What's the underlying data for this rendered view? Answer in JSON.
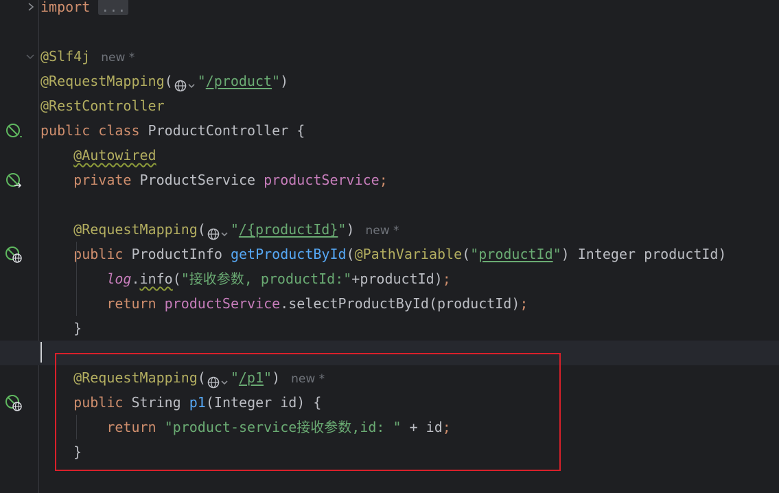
{
  "editor": {
    "lines": [
      {
        "tokens": [
          {
            "t": "import",
            "c": "#cf8e6d"
          },
          {
            "t": " "
          },
          {
            "t": "...",
            "s": "fold"
          }
        ]
      },
      {
        "tokens": []
      },
      {
        "tokens": [
          {
            "t": "@Slf4j",
            "c": "#b3ae60"
          },
          {
            "t": "new *",
            "s": "hint"
          }
        ]
      },
      {
        "tokens": [
          {
            "t": "@RequestMapping",
            "c": "#b3ae60"
          },
          {
            "t": "(",
            "c": "#bcbec4"
          },
          {
            "g": "url-icon"
          },
          {
            "t": "\"",
            "c": "#6aab73"
          },
          {
            "t": "/product",
            "c": "#6aab73",
            "s": "ul"
          },
          {
            "t": "\"",
            "c": "#6aab73"
          },
          {
            "t": ")",
            "c": "#bcbec4"
          }
        ]
      },
      {
        "tokens": [
          {
            "t": "@RestController",
            "c": "#b3ae60"
          }
        ]
      },
      {
        "tokens": [
          {
            "t": "public class ",
            "c": "#cf8e6d"
          },
          {
            "t": "ProductController {",
            "c": "#bcbec4"
          }
        ]
      },
      {
        "tokens": [
          {
            "t": "    "
          },
          {
            "t": "@Autowired",
            "c": "#b3ae60",
            "s": "wavy"
          }
        ]
      },
      {
        "tokens": [
          {
            "t": "    "
          },
          {
            "t": "private ",
            "c": "#cf8e6d"
          },
          {
            "t": "ProductService ",
            "c": "#bcbec4"
          },
          {
            "t": "productService",
            "c": "#c77dbb"
          },
          {
            "t": ";",
            "c": "#cf8e6d"
          }
        ]
      },
      {
        "tokens": []
      },
      {
        "tokens": [
          {
            "t": "    "
          },
          {
            "t": "@RequestMapping",
            "c": "#b3ae60"
          },
          {
            "t": "(",
            "c": "#bcbec4"
          },
          {
            "g": "url-icon"
          },
          {
            "t": "\"",
            "c": "#6aab73"
          },
          {
            "t": "/{productId}",
            "c": "#6aab73",
            "s": "ul"
          },
          {
            "t": "\"",
            "c": "#6aab73"
          },
          {
            "t": ")",
            "c": "#bcbec4"
          },
          {
            "t": "new *",
            "s": "hint"
          }
        ]
      },
      {
        "tokens": [
          {
            "t": "    "
          },
          {
            "t": "public ",
            "c": "#cf8e6d"
          },
          {
            "t": "ProductInfo ",
            "c": "#bcbec4"
          },
          {
            "t": "getProductById",
            "c": "#56a8f5"
          },
          {
            "t": "(",
            "c": "#bcbec4"
          },
          {
            "t": "@PathVariable",
            "c": "#b3ae60"
          },
          {
            "t": "(",
            "c": "#bcbec4"
          },
          {
            "t": "\"",
            "c": "#6aab73"
          },
          {
            "t": "productId",
            "c": "#6aab73",
            "s": "ul"
          },
          {
            "t": "\"",
            "c": "#6aab73"
          },
          {
            "t": ") Integer productId)",
            "c": "#bcbec4"
          }
        ]
      },
      {
        "tokens": [
          {
            "t": "        "
          },
          {
            "t": "log",
            "c": "#c77dbb",
            "i": true
          },
          {
            "t": ".",
            "c": "#bcbec4"
          },
          {
            "t": "info",
            "c": "#bcbec4",
            "s": "wavy"
          },
          {
            "t": "(",
            "c": "#bcbec4"
          },
          {
            "t": "\"接收参数, productId:\"",
            "c": "#6aab73"
          },
          {
            "t": "+productId)",
            "c": "#bcbec4"
          },
          {
            "t": ";",
            "c": "#cf8e6d"
          }
        ]
      },
      {
        "tokens": [
          {
            "t": "        "
          },
          {
            "t": "return ",
            "c": "#cf8e6d"
          },
          {
            "t": "productService",
            "c": "#c77dbb"
          },
          {
            "t": ".selectProductById(productId)",
            "c": "#bcbec4"
          },
          {
            "t": ";",
            "c": "#cf8e6d"
          }
        ]
      },
      {
        "tokens": [
          {
            "t": "    "
          },
          {
            "t": "}",
            "c": "#bcbec4"
          }
        ]
      },
      {
        "tokens": []
      },
      {
        "tokens": [
          {
            "t": "    "
          },
          {
            "t": "@RequestMapping",
            "c": "#b3ae60"
          },
          {
            "t": "(",
            "c": "#bcbec4"
          },
          {
            "g": "url-icon"
          },
          {
            "t": "\"",
            "c": "#6aab73"
          },
          {
            "t": "/p1",
            "c": "#6aab73",
            "s": "ul"
          },
          {
            "t": "\"",
            "c": "#6aab73"
          },
          {
            "t": ")",
            "c": "#bcbec4"
          },
          {
            "t": "new *",
            "s": "hint"
          }
        ]
      },
      {
        "tokens": [
          {
            "t": "    "
          },
          {
            "t": "public ",
            "c": "#cf8e6d"
          },
          {
            "t": "String ",
            "c": "#bcbec4"
          },
          {
            "t": "p1",
            "c": "#56a8f5"
          },
          {
            "t": "(Integer id) {",
            "c": "#bcbec4"
          }
        ]
      },
      {
        "tokens": [
          {
            "t": "        "
          },
          {
            "t": "return ",
            "c": "#cf8e6d"
          },
          {
            "t": "\"product-service接收参数,id: \"",
            "c": "#6aab73"
          },
          {
            "t": " + id",
            "c": "#bcbec4"
          },
          {
            "t": ";",
            "c": "#cf8e6d"
          }
        ]
      },
      {
        "tokens": [
          {
            "t": "    "
          },
          {
            "t": "}",
            "c": "#bcbec4"
          }
        ]
      }
    ]
  },
  "gutter_icons": [
    {
      "line": 5,
      "icon": "no-bean-icon"
    },
    {
      "line": 7,
      "icon": "autowired-navigate-icon"
    },
    {
      "line": 10,
      "icon": "endpoint-web-icon"
    },
    {
      "line": 16,
      "icon": "endpoint-web-icon"
    }
  ],
  "colors": {
    "background": "#1e1f22",
    "keyword": "#cf8e6d",
    "annotation": "#b3ae60",
    "string": "#6aab73",
    "field": "#c77dbb",
    "method": "#56a8f5",
    "text": "#bcbec4",
    "gutter_icon": "#5fb85f",
    "highlight_border": "#d9202a"
  }
}
